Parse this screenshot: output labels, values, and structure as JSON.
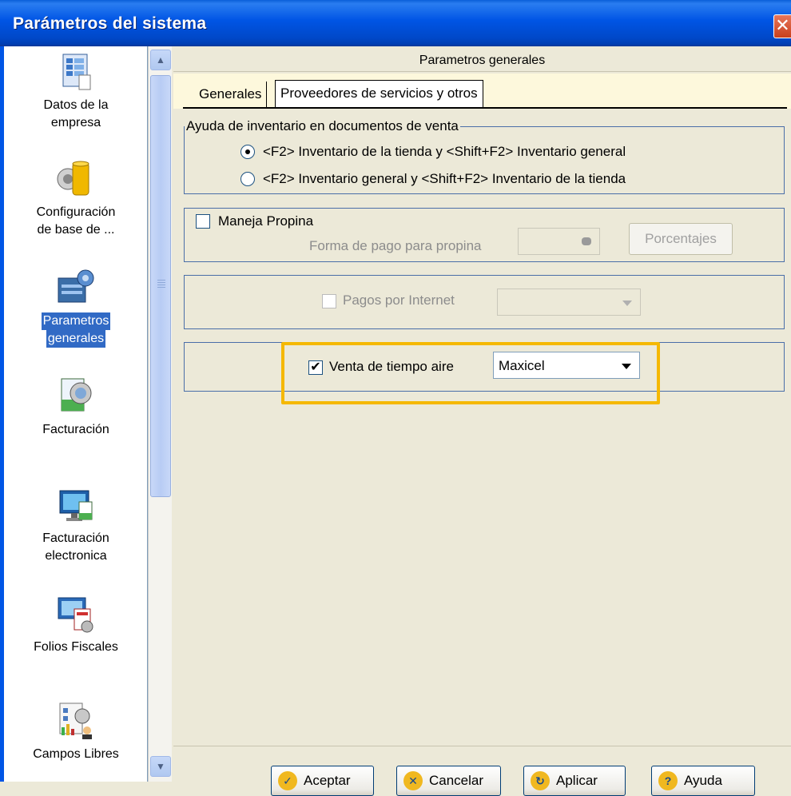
{
  "window": {
    "title": "Parámetros del sistema",
    "close_glyph": "✕"
  },
  "sidebar": {
    "items": [
      {
        "label_line1": "Datos de la",
        "label_line2": "empresa",
        "icon": "spreadsheet-icon"
      },
      {
        "label_line1": "Configuración",
        "label_line2": "de base de ...",
        "icon": "database-icon"
      },
      {
        "label_line1": "Parametros",
        "label_line2": "generales",
        "icon": "params-icon",
        "selected": true
      },
      {
        "label_line1": "Facturación",
        "label_line2": "",
        "icon": "invoice-icon"
      },
      {
        "label_line1": "Facturación",
        "label_line2": "electronica",
        "icon": "e-invoice-icon"
      },
      {
        "label_line1": "Folios Fiscales",
        "label_line2": "",
        "icon": "fiscal-folios-icon"
      },
      {
        "label_line1": "Campos Libres",
        "label_line2": "",
        "icon": "custom-fields-icon"
      }
    ]
  },
  "panel": {
    "header": "Parametros generales",
    "tabs": [
      {
        "label": "Generales",
        "active": false
      },
      {
        "label": "Proveedores de servicios y otros",
        "active": true
      }
    ],
    "inventory_group": {
      "legend": "Ayuda de inventario en documentos de venta",
      "options": [
        {
          "label": "<F2> Inventario de la tienda y <Shift+F2> Inventario general",
          "selected": true
        },
        {
          "label": "<F2> Inventario general y <Shift+F2> Inventario de la tienda",
          "selected": false
        }
      ]
    },
    "tip_group": {
      "checkbox_label": "Maneja Propina",
      "checked": false,
      "payment_label": "Forma de pago para propina",
      "payment_value": "",
      "percentages_button": "Porcentajes"
    },
    "internet_group": {
      "checkbox_label": "Pagos por Internet",
      "checked": false,
      "enabled": false,
      "value": ""
    },
    "airtime_group": {
      "checkbox_label": "Venta de tiempo aire",
      "checked": true,
      "provider_value": "Maxicel"
    }
  },
  "footer": {
    "accept": "Aceptar",
    "cancel": "Cancelar",
    "apply": "Aplicar",
    "help": "Ayuda"
  },
  "colors": {
    "selection": "#316ac5",
    "highlight": "#f5b800",
    "titlebar": "#0055e5"
  }
}
